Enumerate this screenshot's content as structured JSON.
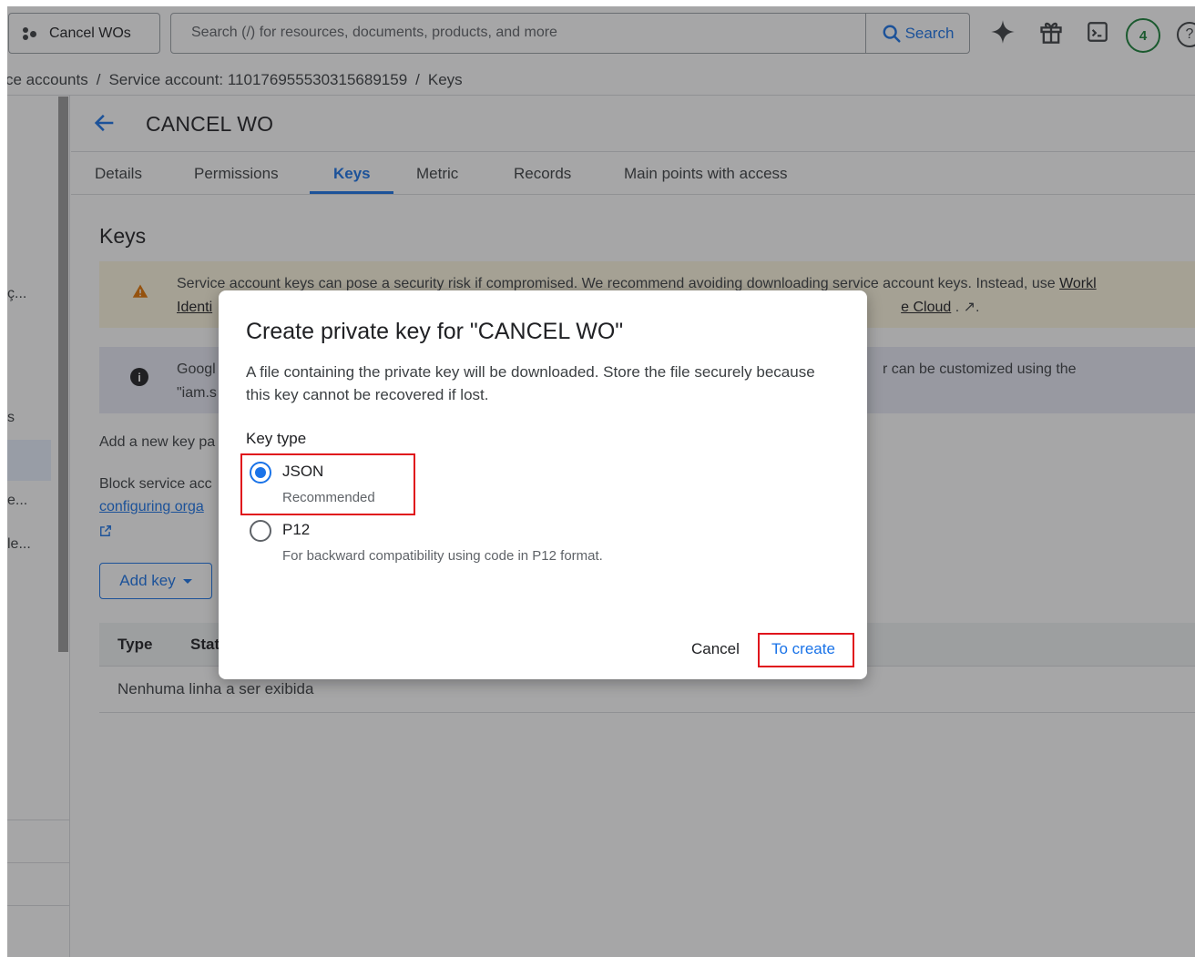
{
  "topbar": {
    "project_label": "Cancel WOs",
    "search_placeholder": "Search (/) for resources, documents, products, and more",
    "search_button": "Search",
    "notifications_count": "4",
    "help_glyph": "?"
  },
  "breadcrumb": {
    "items": [
      "ce accounts",
      "Service account: 110176955530315689159",
      "Keys"
    ]
  },
  "leftnav": {
    "fragments": [
      "ç...",
      "s",
      "e...",
      "le..."
    ]
  },
  "header": {
    "title": "CANCEL WO"
  },
  "tabs": [
    {
      "label": "Details",
      "active": false
    },
    {
      "label": "Permissions",
      "active": false
    },
    {
      "label": "Keys",
      "active": true
    },
    {
      "label": "Metric",
      "active": false
    },
    {
      "label": "Records",
      "active": false
    },
    {
      "label": "Main points with access",
      "active": false
    }
  ],
  "main": {
    "section_title": "Keys",
    "warning": {
      "line1": "Service account keys can pose a security risk if compromised. We recommend avoiding downloading service account keys. Instead, use ",
      "line1_link": "Workl",
      "line2_link_left": "Identi",
      "line2_link_right": "e Cloud",
      "line2_suffix": " . ↗."
    },
    "info": {
      "line1_left": "Googl",
      "line2_left": "\"iam.s",
      "line1_right": "r can be customized using the"
    },
    "add_pair_text": "Add a new key pa",
    "block_text": "Block service acc",
    "configuring_link": "configuring orga",
    "add_key_label": "Add key",
    "table": {
      "columns": [
        "Type",
        "Stat"
      ],
      "empty_message": "Nenhuma linha a ser exibida"
    }
  },
  "dialog": {
    "title": "Create private key for \"CANCEL WO\"",
    "description": "A file containing the private key will be downloaded. Store the file securely because this key cannot be recovered if lost.",
    "key_type_label": "Key type",
    "options": [
      {
        "label": "JSON",
        "sublabel": "Recommended",
        "checked": true
      },
      {
        "label": "P12",
        "sublabel": "For backward compatibility using code in P12 format.",
        "checked": false
      }
    ],
    "cancel_label": "Cancel",
    "create_label": "To create"
  },
  "colors": {
    "accent": "#1a73e8",
    "warning_bg": "#fef7e0",
    "info_bg": "#e8eaf6",
    "highlight": "#e0131c",
    "badge": "#188038"
  },
  "icons": [
    "project-dots-icon",
    "search-icon",
    "sparkle-icon",
    "gift-icon",
    "terminal-icon",
    "help-icon",
    "arrow-back-icon",
    "warning-icon",
    "info-icon",
    "external-link-icon",
    "dropdown-caret-icon"
  ]
}
